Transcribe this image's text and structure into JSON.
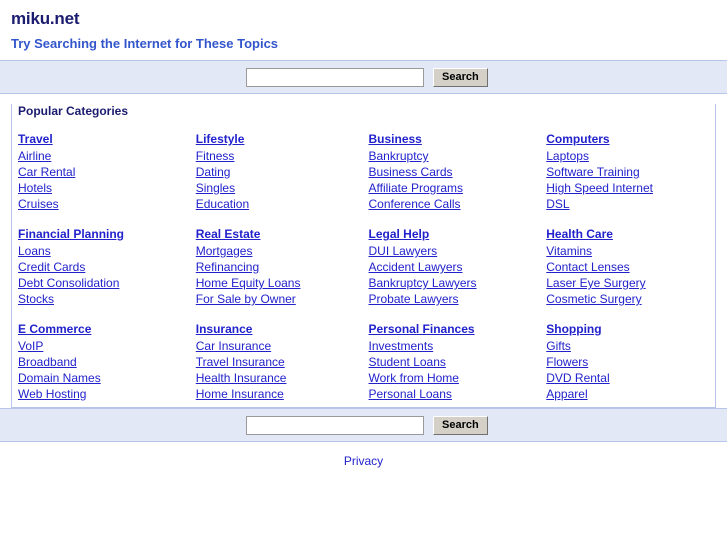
{
  "header": {
    "site_title": "miku.net",
    "tagline": "Try Searching the Internet for These Topics"
  },
  "search_top": {
    "input_value": "",
    "placeholder": "",
    "button_label": "Search"
  },
  "search_bottom": {
    "input_value": "",
    "placeholder": "",
    "button_label": "Search"
  },
  "panel": {
    "title": "Popular Categories"
  },
  "categories": [
    {
      "heading": "Travel",
      "links": [
        "Airline",
        "Car Rental",
        "Hotels",
        "Cruises"
      ]
    },
    {
      "heading": "Lifestyle",
      "links": [
        "Fitness",
        "Dating",
        "Singles",
        "Education"
      ]
    },
    {
      "heading": "Business",
      "links": [
        "Bankruptcy",
        "Business Cards",
        "Affiliate Programs",
        "Conference Calls"
      ]
    },
    {
      "heading": "Computers",
      "links": [
        "Laptops",
        "Software Training",
        "High Speed Internet",
        "DSL"
      ]
    },
    {
      "heading": "Financial Planning",
      "links": [
        "Loans",
        "Credit Cards",
        "Debt Consolidation",
        "Stocks"
      ]
    },
    {
      "heading": "Real Estate",
      "links": [
        "Mortgages",
        "Refinancing",
        "Home Equity Loans",
        "For Sale by Owner"
      ]
    },
    {
      "heading": "Legal Help",
      "links": [
        "DUI Lawyers",
        "Accident Lawyers",
        "Bankruptcy Lawyers",
        "Probate Lawyers"
      ]
    },
    {
      "heading": "Health Care",
      "links": [
        "Vitamins",
        "Contact Lenses",
        "Laser Eye Surgery",
        "Cosmetic Surgery"
      ]
    },
    {
      "heading": "E Commerce",
      "links": [
        "VoIP",
        "Broadband",
        "Domain Names",
        "Web Hosting"
      ]
    },
    {
      "heading": "Insurance",
      "links": [
        "Car Insurance",
        "Travel Insurance",
        "Health Insurance",
        "Home Insurance"
      ]
    },
    {
      "heading": "Personal Finances",
      "links": [
        "Investments",
        "Student Loans",
        "Work from Home",
        "Personal Loans"
      ]
    },
    {
      "heading": "Shopping",
      "links": [
        "Gifts",
        "Flowers",
        "DVD Rental",
        "Apparel"
      ]
    }
  ],
  "footer": {
    "privacy_label": "Privacy"
  },
  "colors": {
    "band_background": "#e2e8f6",
    "band_border": "#b7c5e8",
    "link": "#2222cc",
    "title": "#1b1b6f",
    "tagline": "#3355cc",
    "button_face": "#d4d0c8"
  }
}
